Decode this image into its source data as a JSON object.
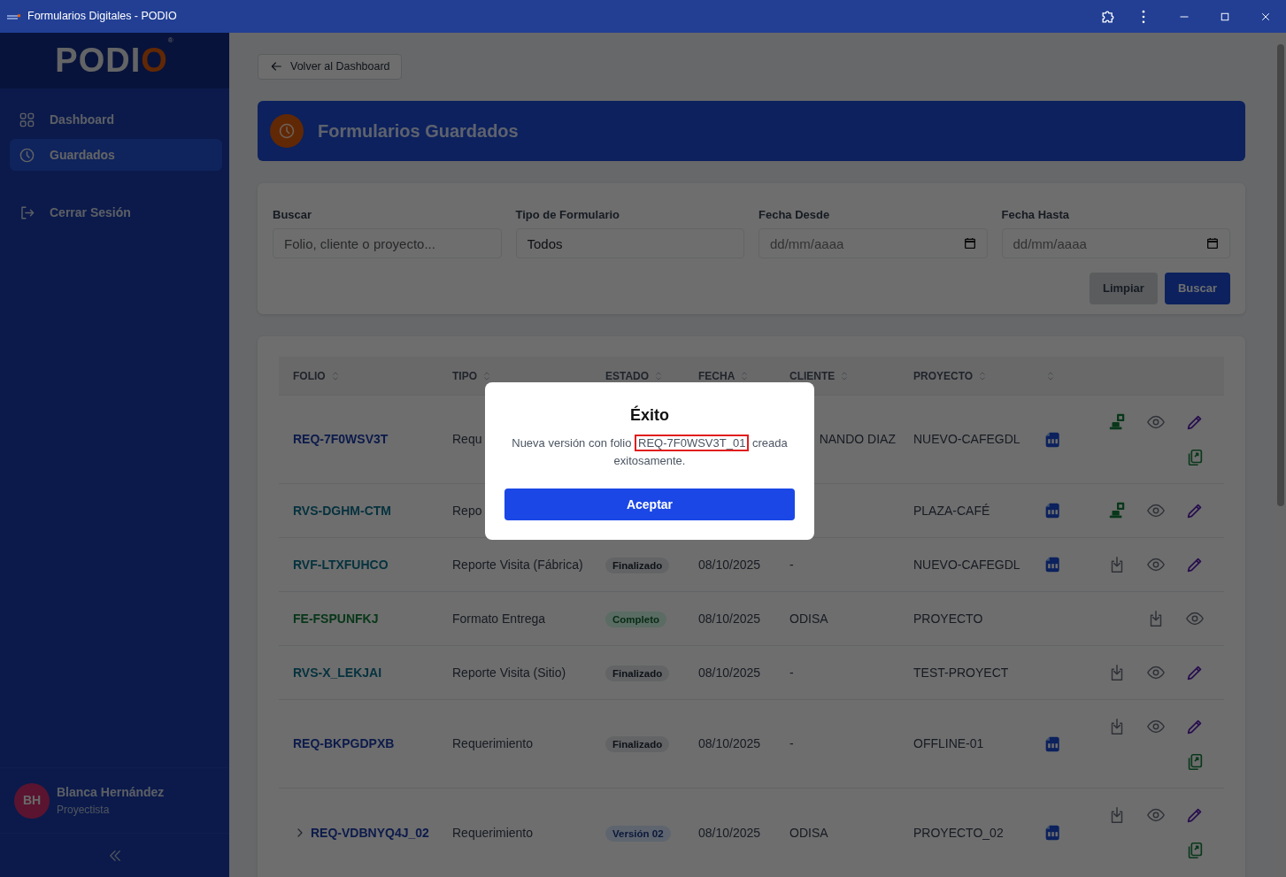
{
  "window": {
    "title": "Formularios Digitales - PODIO"
  },
  "sidebar": {
    "logo": "PODIO",
    "logo_mark": "®",
    "items": [
      {
        "label": "Dashboard",
        "selected": false
      },
      {
        "label": "Guardados",
        "selected": true
      }
    ],
    "logout": "Cerrar Sesión",
    "user": {
      "initials": "BH",
      "name": "Blanca Hernández",
      "role": "Proyectista"
    }
  },
  "back_button": "Volver al Dashboard",
  "page_title": "Formularios Guardados",
  "filters": {
    "fields": [
      {
        "label": "Buscar",
        "kind": "text",
        "placeholder": "Folio, cliente o proyecto..."
      },
      {
        "label": "Tipo de Formulario",
        "kind": "select",
        "value": "Todos"
      },
      {
        "label": "Fecha Desde",
        "kind": "date",
        "placeholder": "dd/mm/aaaa"
      },
      {
        "label": "Fecha Hasta",
        "kind": "date",
        "placeholder": "dd/mm/aaaa"
      }
    ],
    "buttons": [
      {
        "label": "Limpiar",
        "kind": "secondary",
        "disabled": true
      },
      {
        "label": "Buscar",
        "kind": "primary",
        "disabled": false
      }
    ]
  },
  "table": {
    "columns": [
      {
        "label": "FOLIO",
        "sortable": true
      },
      {
        "label": "TIPO",
        "sortable": true
      },
      {
        "label": "ESTADO",
        "sortable": true
      },
      {
        "label": "FECHA",
        "sortable": true
      },
      {
        "label": "CLIENTE",
        "sortable": true
      },
      {
        "label": "PROYECTO",
        "sortable": true
      },
      {
        "sortable": true
      }
    ],
    "rows": [
      {
        "kind": "single",
        "folio": {
          "text": "REQ-7F0WSV3T",
          "kind": "requerimiento"
        },
        "tipo": "Requ",
        "cliente": "NANDO DIAZ",
        "cliente_partial": true,
        "proyecto": "NUEVO-CAFEGDL",
        "pdf": true,
        "actions": [
          {
            "kind": "sync"
          },
          {
            "kind": "view"
          },
          {
            "kind": "edit"
          },
          {
            "kind": "copy"
          }
        ]
      },
      {
        "kind": "single",
        "folio": {
          "text": "RVS-DGHM-CTM",
          "kind": "reporte"
        },
        "tipo": "Repo",
        "proyecto": "PLAZA-CAFÉ",
        "pdf": true,
        "actions": [
          {
            "kind": "sync"
          },
          {
            "kind": "view"
          },
          {
            "kind": "edit"
          }
        ]
      },
      {
        "kind": "single",
        "folio": {
          "text": "RVF-LTXFUHCO",
          "kind": "reporte"
        },
        "tipo": "Reporte Visita (Fábrica)",
        "estado": {
          "text": "Finalizado",
          "kind": "neutral"
        },
        "fecha": "08/10/2025",
        "cliente": "-",
        "proyecto": "NUEVO-CAFEGDL",
        "pdf": true,
        "actions": [
          {
            "kind": "download"
          },
          {
            "kind": "view"
          },
          {
            "kind": "edit"
          }
        ]
      },
      {
        "kind": "single",
        "folio": {
          "text": "FE-FSPUNFKJ",
          "kind": "entrega"
        },
        "tipo": "Formato Entrega",
        "estado": {
          "text": "Completo",
          "kind": "success"
        },
        "fecha": "08/10/2025",
        "cliente": "ODISA",
        "proyecto": "PROYECTO",
        "pdf": false,
        "actions": [
          {
            "kind": "download"
          },
          {
            "kind": "view"
          }
        ]
      },
      {
        "kind": "single",
        "folio": {
          "text": "RVS-X_LEKJAI",
          "kind": "reporte"
        },
        "tipo": "Reporte Visita (Sitio)",
        "estado": {
          "text": "Finalizado",
          "kind": "neutral"
        },
        "fecha": "08/10/2025",
        "cliente": "-",
        "proyecto": "TEST-PROYECT",
        "pdf": false,
        "actions": [
          {
            "kind": "download"
          },
          {
            "kind": "view"
          },
          {
            "kind": "edit"
          }
        ]
      },
      {
        "kind": "single",
        "folio": {
          "text": "REQ-BKPGDPXB",
          "kind": "requerimiento"
        },
        "tipo": "Requerimiento",
        "estado": {
          "text": "Finalizado",
          "kind": "neutral"
        },
        "fecha": "08/10/2025",
        "cliente": "-",
        "proyecto": "OFFLINE-01",
        "pdf": true,
        "actions": [
          {
            "kind": "download"
          },
          {
            "kind": "view"
          },
          {
            "kind": "edit"
          },
          {
            "kind": "copy"
          }
        ]
      },
      {
        "kind": "group",
        "expanded": false,
        "folio": {
          "text": "REQ-VDBNYQ4J_02",
          "kind": "requerimiento"
        },
        "tipo": "Requerimiento",
        "estado": {
          "text": "Versión 02",
          "kind": "info"
        },
        "fecha": "08/10/2025",
        "cliente": "ODISA",
        "proyecto": "PROYECTO_02",
        "pdf": true,
        "actions": [
          {
            "kind": "download"
          },
          {
            "kind": "view"
          },
          {
            "kind": "edit"
          },
          {
            "kind": "copy"
          }
        ]
      }
    ]
  },
  "dialog": {
    "title": "Éxito",
    "message": {
      "prefix": "Nueva versión con folio",
      "highlight": "REQ-7F0WSV3T_01",
      "suffix": "creada exitosamente."
    },
    "button": "Aceptar"
  }
}
